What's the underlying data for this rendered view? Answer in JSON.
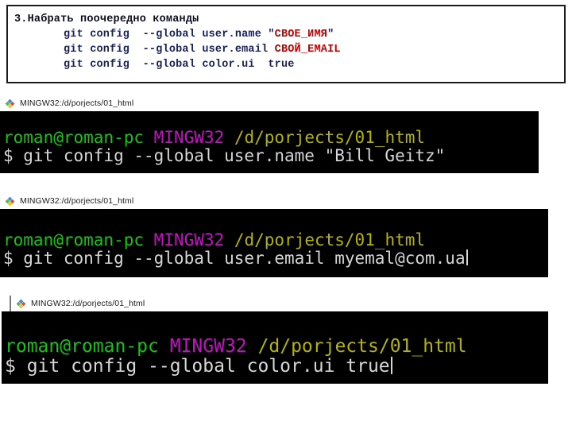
{
  "instruction": {
    "title": "3.Набрать поочередно команды",
    "commands": [
      {
        "prefix": "git config  --global user.name ",
        "quote_open": "\"",
        "accent": "СВОЕ_ИМЯ",
        "quote_close": "\"",
        "suffix": ""
      },
      {
        "prefix": "git config  --global user.email ",
        "quote_open": "",
        "accent": "СВОЙ_EMAIL",
        "quote_close": "",
        "suffix": ""
      },
      {
        "prefix": "git config  --global color.ui  true",
        "quote_open": "",
        "accent": "",
        "quote_close": "",
        "suffix": ""
      }
    ],
    "accent_color": "#c00000",
    "text_color": "#17205c",
    "border_color": "#1b1b1b"
  },
  "terminals": [
    {
      "window_title": "MINGW32:/d/porjects/01_html",
      "icon": "mintty-icon",
      "prompt_user": "roman@roman-pc",
      "prompt_shell": "MINGW32",
      "prompt_path": "/d/porjects/01_html",
      "command": "$ git config --global user.name \"Bill Geitz\"",
      "has_cursor": false,
      "colors": {
        "background": "#000000",
        "user": "#12c612",
        "shell": "#c312c3",
        "path": "#b5b500",
        "command": "#d6d6d6"
      }
    },
    {
      "window_title": "MINGW32:/d/porjects/01_html",
      "icon": "mintty-icon",
      "prompt_user": "roman@roman-pc",
      "prompt_shell": "MINGW32",
      "prompt_path": "/d/porjects/01_html",
      "command": "$ git config --global user.email myemal@com.ua",
      "has_cursor": true,
      "colors": {
        "background": "#000000",
        "user": "#12c612",
        "shell": "#c312c3",
        "path": "#b5b500",
        "command": "#d6d6d6"
      }
    },
    {
      "window_title": "MINGW32:/d/porjects/01_html",
      "icon": "mintty-icon",
      "prompt_user": "roman@roman-pc",
      "prompt_shell": "MINGW32",
      "prompt_path": "/d/porjects/01_html",
      "command": "$ git config --global color.ui true",
      "has_cursor": true,
      "colors": {
        "background": "#000000",
        "user": "#12c612",
        "shell": "#c312c3",
        "path": "#b5b500",
        "command": "#d6d6d6"
      }
    }
  ]
}
